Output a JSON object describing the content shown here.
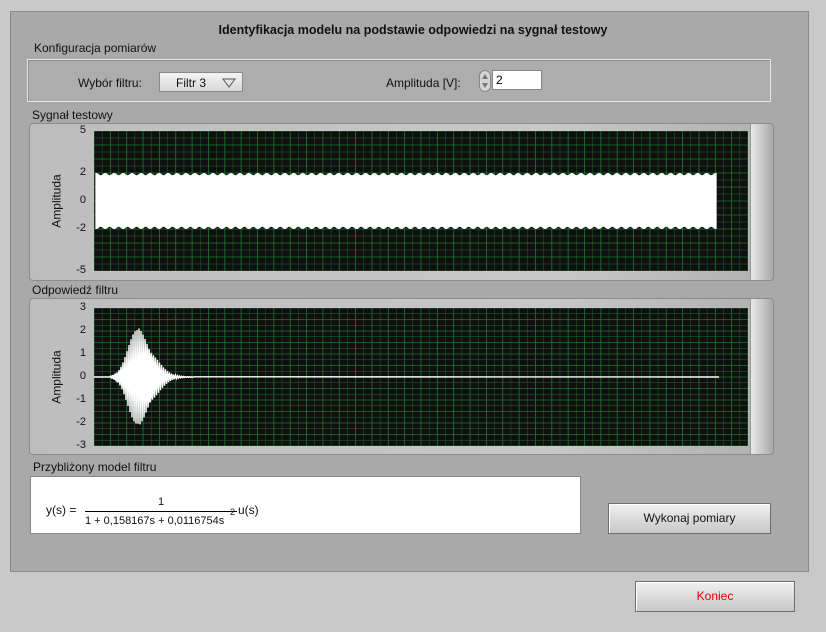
{
  "title": "Identyfikacja modelu na podstawie odpowiedzi na sygnał testowy",
  "config": {
    "section_label": "Konfiguracja pomiarów",
    "filter_label": "Wybór filtru:",
    "filter_value": "Filtr 3",
    "amplitude_label": "Amplituda [V]:",
    "amplitude_value": "2"
  },
  "test_signal": {
    "section_label": "Sygnał testowy",
    "y_label": "Amplituda",
    "y_ticks": [
      "5",
      "2",
      "0",
      "-2",
      "-5"
    ],
    "y_range": [
      -5,
      5
    ],
    "signal_amplitude": 2
  },
  "filter_response": {
    "section_label": "Odpowiedź filtru",
    "y_label": "Amplituda",
    "y_ticks": [
      "3",
      "2",
      "1",
      "0",
      "-1",
      "-2",
      "-3"
    ],
    "y_range": [
      -3,
      3
    ],
    "peak_amplitude": 2.1
  },
  "model": {
    "section_label": "Przybliżony model filtru",
    "lhs": "y(s) =",
    "numerator": "1",
    "denominator": "1 + 0,158167s + 0,0116754s",
    "exponent": "2",
    "rhs": "u(s)"
  },
  "buttons": {
    "measure": "Wykonaj pomiary",
    "end": "Koniec"
  },
  "colors": {
    "plot_bg": "#0f0f0f",
    "grid": "#1e7a2e",
    "trace": "#ffffff",
    "end_text": "#e00000"
  }
}
